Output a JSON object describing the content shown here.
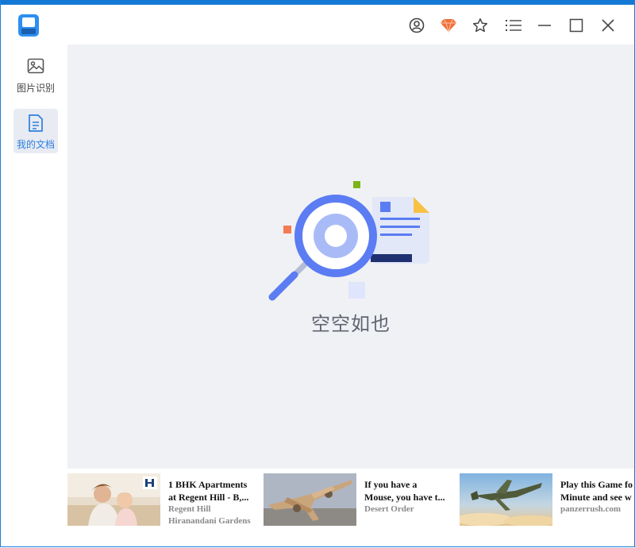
{
  "window": {
    "toolbar_icons": [
      "user-circle-icon",
      "diamond-icon",
      "star-icon",
      "list-menu-icon",
      "minimize-icon",
      "maximize-icon",
      "close-icon"
    ]
  },
  "sidebar": {
    "items": [
      {
        "label": "图片识别",
        "icon": "image-icon",
        "active": false
      },
      {
        "label": "我的文档",
        "icon": "document-icon",
        "active": true
      }
    ]
  },
  "main": {
    "empty_text": "空空如也"
  },
  "ads": [
    {
      "title_line1": "1 BHK Apartments",
      "title_line2": "at Regent Hill - B,...",
      "source_line1": "Regent Hill",
      "source_line2": "Hiranandani Gardens"
    },
    {
      "title_line1": "If you have a",
      "title_line2": "Mouse, you have t...",
      "source_line1": "Desert Order",
      "source_line2": ""
    },
    {
      "title_line1": "Play this Game fo",
      "title_line2": "Minute and see w",
      "source_line1": "panzerrush.com",
      "source_line2": ""
    }
  ],
  "colors": {
    "accent": "#1479d4",
    "sidebar_active_bg": "#e8ebf2",
    "main_bg": "#f0f1f5",
    "diamond": "#f0703a",
    "illustration_blue": "#5b7cf2"
  }
}
